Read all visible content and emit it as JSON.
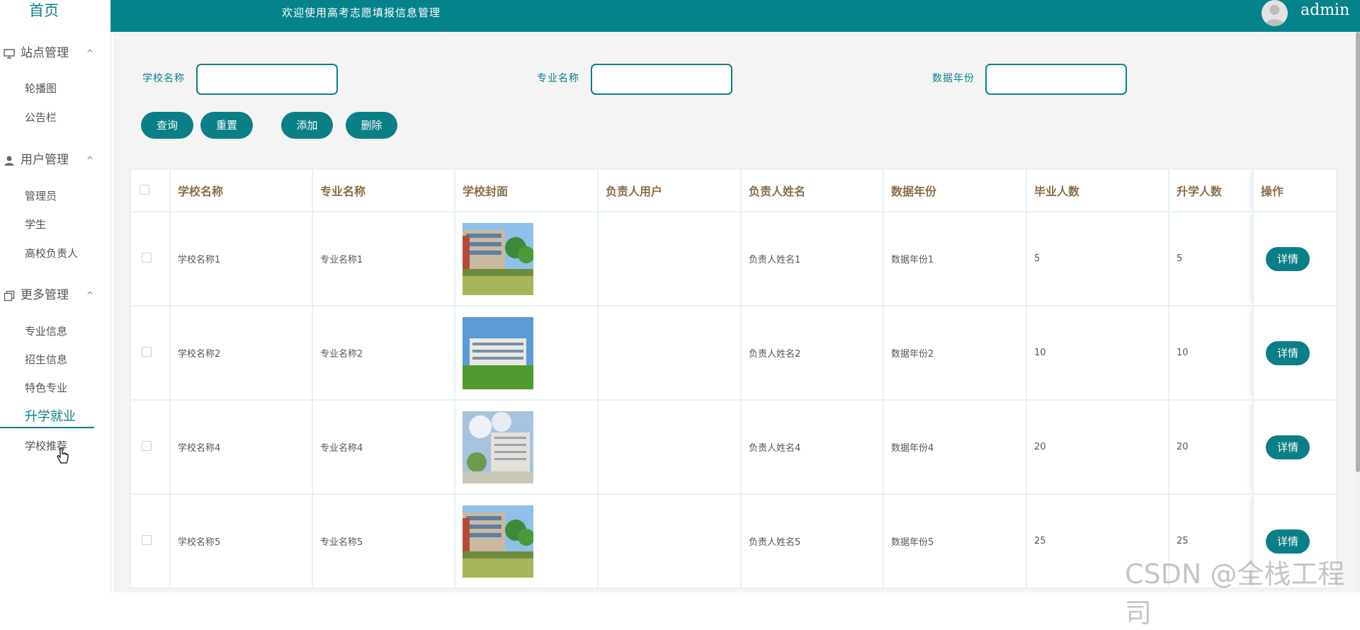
{
  "sidebar": {
    "home": "首页",
    "groups": [
      {
        "label": "站点管理",
        "icon": "monitor-icon",
        "items": [
          "轮播图",
          "公告栏"
        ]
      },
      {
        "label": "用户管理",
        "icon": "user-icon",
        "items": [
          "管理员",
          "学生",
          "高校负责人"
        ]
      },
      {
        "label": "更多管理",
        "icon": "copy-icon",
        "items": [
          "专业信息",
          "招生信息",
          "特色专业",
          "升学就业",
          "学校推荐"
        ]
      }
    ],
    "active_item": "升学就业"
  },
  "topbar": {
    "welcome": "欢迎使用高考志愿填报信息管理",
    "username": "admin"
  },
  "filters": {
    "school_label": "学校名称",
    "major_label": "专业名称",
    "year_label": "数据年份",
    "school_value": "",
    "major_value": "",
    "year_value": ""
  },
  "buttons": {
    "query": "查询",
    "reset": "重置",
    "add": "添加",
    "delete": "删除"
  },
  "table": {
    "headers": [
      "学校名称",
      "专业名称",
      "学校封面",
      "负责人用户",
      "负责人姓名",
      "数据年份",
      "毕业人数",
      "升学人数",
      "操作"
    ],
    "rows": [
      {
        "school": "学校名称1",
        "major": "专业名称1",
        "owner_user": "",
        "owner_name": "负责人姓名1",
        "year": "数据年份1",
        "graduates": "5",
        "enrolled": "5",
        "action": "详情"
      },
      {
        "school": "学校名称2",
        "major": "专业名称2",
        "owner_user": "",
        "owner_name": "负责人姓名2",
        "year": "数据年份2",
        "graduates": "10",
        "enrolled": "10",
        "action": "详情"
      },
      {
        "school": "学校名称4",
        "major": "专业名称4",
        "owner_user": "",
        "owner_name": "负责人姓名4",
        "year": "数据年份4",
        "graduates": "20",
        "enrolled": "20",
        "action": "详情"
      },
      {
        "school": "学校名称5",
        "major": "专业名称5",
        "owner_user": "",
        "owner_name": "负责人姓名5",
        "year": "数据年份5",
        "graduates": "25",
        "enrolled": "25",
        "action": "详情"
      }
    ]
  },
  "watermark": "CSDN @全栈工程司",
  "colors": {
    "accent": "#05838b",
    "header_text": "#8a6d4a",
    "background": "#f4f4f4"
  }
}
